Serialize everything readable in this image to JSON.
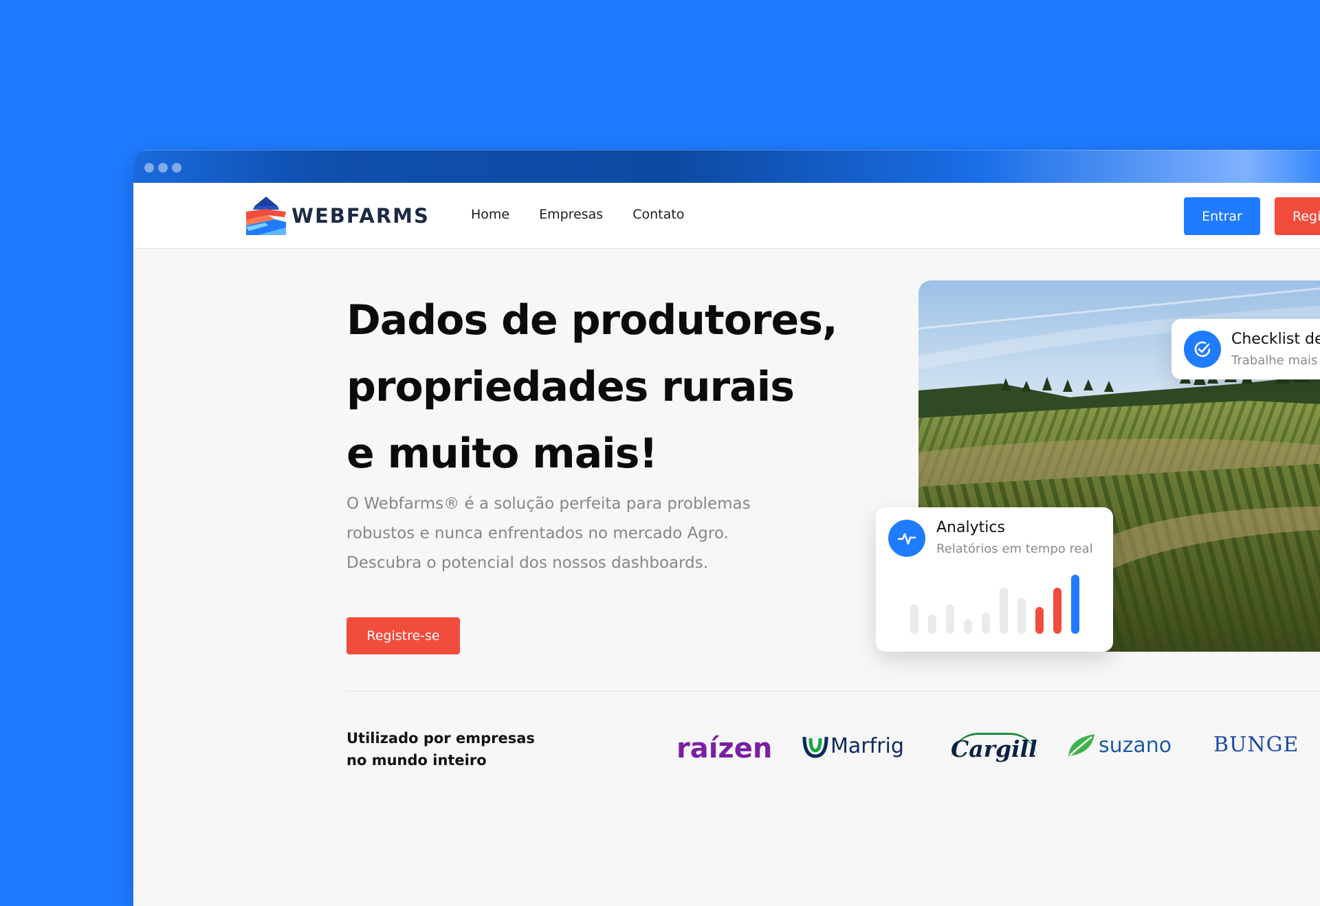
{
  "nav": {
    "logo_text": "WEBFARMS",
    "links": [
      "Home",
      "Empresas",
      "Contato"
    ],
    "login_label": "Entrar",
    "register_label": "Regi"
  },
  "hero": {
    "title_lines": [
      "Dados de produtores,",
      "propriedades rurais",
      "e muito mais!"
    ],
    "description_lines": [
      "O Webfarms® é a solução perfeita para problemas",
      "robustos e nunca enfrentados no mercado Agro.",
      "Descubra o potencial dos nossos dashboards."
    ],
    "cta_label": "Registre-se"
  },
  "checklist_card": {
    "title": "Checklist de",
    "subtitle": "Trabalhe mais",
    "icon": "check-circle-icon"
  },
  "analytics_card": {
    "title": "Analytics",
    "subtitle": "Relatórios em tempo real",
    "icon": "activity-icon",
    "bar_levels": [
      0.5,
      0.32,
      0.5,
      0.24,
      0.36,
      0.78,
      0.6,
      0.45,
      0.78,
      1.0
    ],
    "bar_colors": [
      "#e9e9ee",
      "#e9e9ee",
      "#e9e9ee",
      "#e9e9ee",
      "#e9e9ee",
      "#e9e9ee",
      "#e9e9ee",
      "#f24c3d",
      "#f24c3d",
      "#1f7bff"
    ]
  },
  "companies": {
    "label_lines": [
      "Utilizado por empresas",
      "no mundo inteiro"
    ],
    "brands": [
      "raízen",
      "Marfrig",
      "Cargill",
      "suzano",
      "BUNGE"
    ]
  },
  "colors": {
    "accent_blue": "#1f7bff",
    "accent_red": "#f24c3d",
    "page_bg": "#f7f7f7"
  }
}
